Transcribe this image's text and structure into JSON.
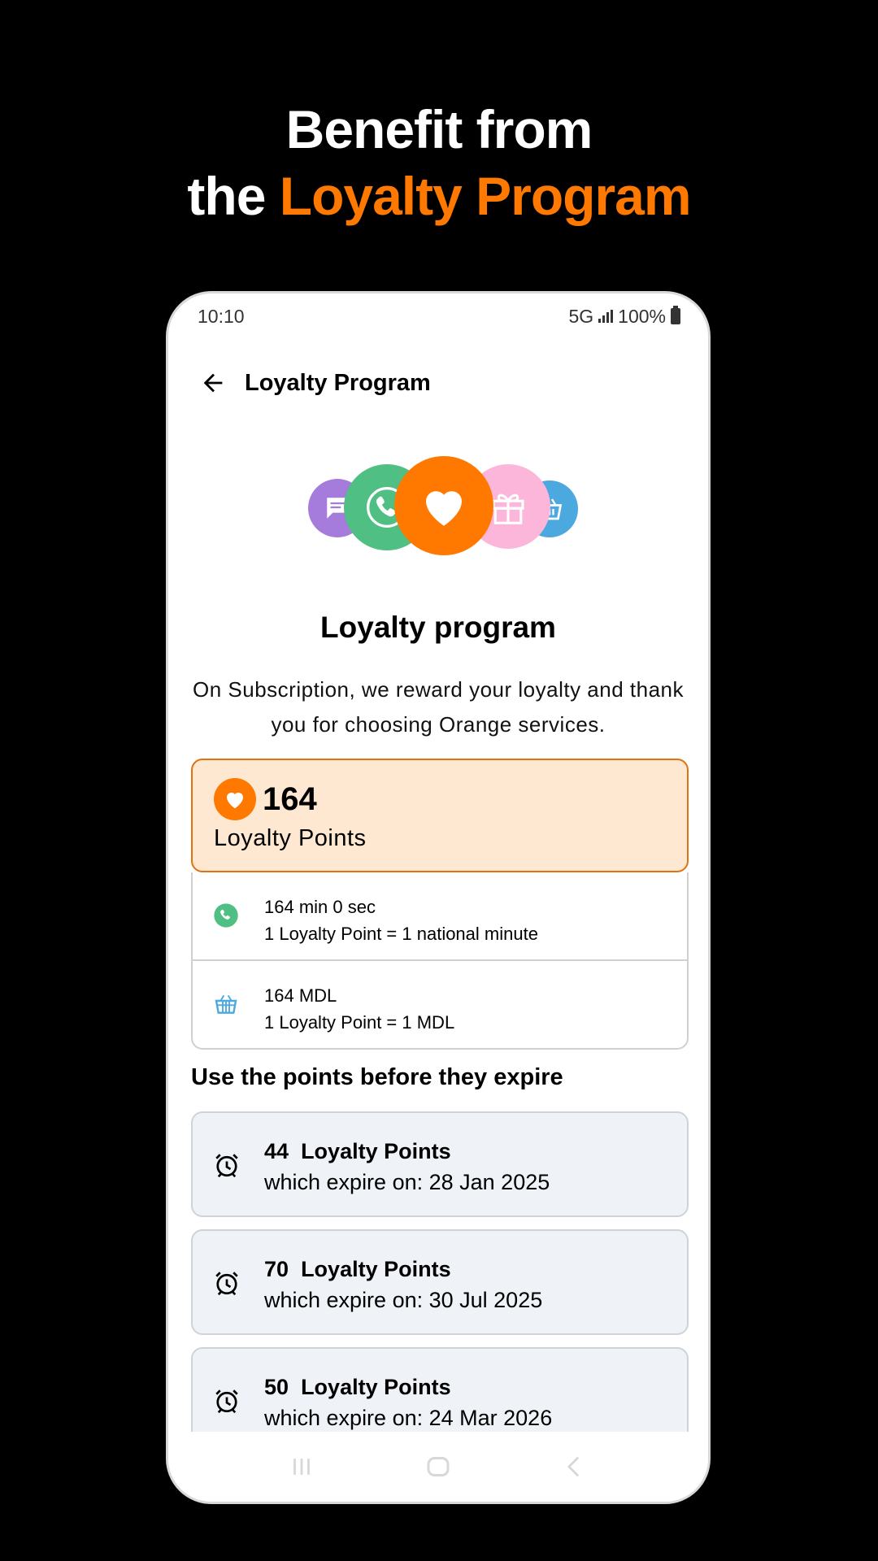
{
  "promo": {
    "line1": "Benefit from",
    "line2_plain": "the",
    "line2_accent": "Loyalty Program"
  },
  "status": {
    "time": "10:10",
    "network": "5G",
    "battery": "100%"
  },
  "appbar": {
    "title": "Loyalty Program"
  },
  "content": {
    "title": "Loyalty program",
    "description": "On Subscription, we reward your loyalty and thank you for choosing Orange services."
  },
  "points": {
    "value": "164",
    "label": "Loyalty Points"
  },
  "conversions": [
    {
      "line1": "164 min 0 sec",
      "line2": "1 Loyalty Point = 1 national minute",
      "icon": "phone-icon"
    },
    {
      "line1": "164 MDL",
      "line2": "1 Loyalty Point = 1 MDL",
      "icon": "basket-icon"
    }
  ],
  "expiry_heading": "Use the points before they expire",
  "expiries": [
    {
      "amount": "44",
      "unit": "Loyalty Points",
      "when": "which expire on: 28 Jan 2025"
    },
    {
      "amount": "70",
      "unit": "Loyalty Points",
      "when": "which expire on: 30 Jul 2025"
    },
    {
      "amount": "50",
      "unit": "Loyalty Points",
      "when": "which expire on: 24 Mar 2026"
    }
  ],
  "colors": {
    "accent": "#ff7900",
    "card_bg": "#fee8d1",
    "expiry_bg": "#eff3f8",
    "green": "#4fbf84",
    "blue": "#4ba9e0",
    "purple": "#a57bdb",
    "pink": "#fbb6d9"
  }
}
